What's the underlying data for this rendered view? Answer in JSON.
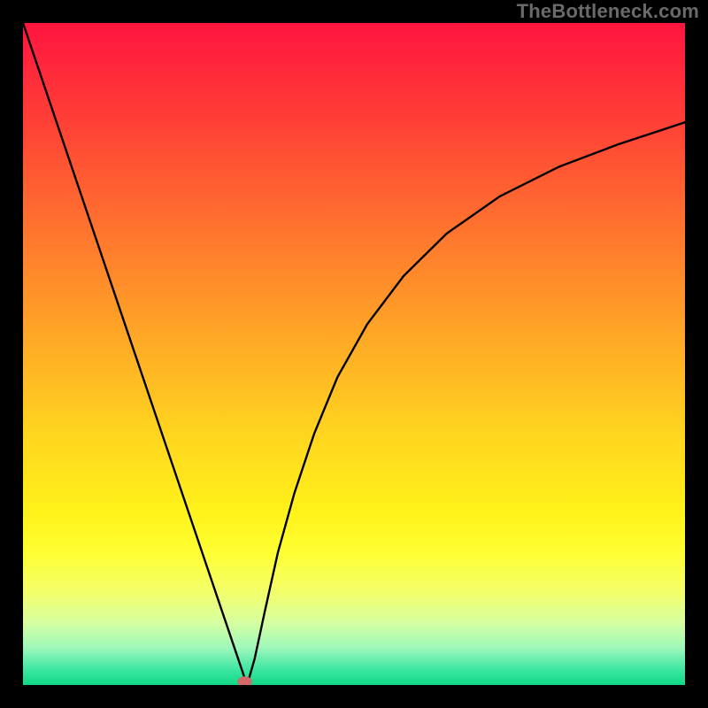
{
  "watermark": "TheBottleneck.com",
  "chart_data": {
    "type": "line",
    "title": "",
    "xlabel": "",
    "ylabel": "",
    "xlim": [
      0,
      100
    ],
    "ylim": [
      0,
      100
    ],
    "grid": false,
    "background": {
      "kind": "vertical-gradient",
      "stops": [
        {
          "offset": 0.0,
          "color": "#ff153f"
        },
        {
          "offset": 0.14,
          "color": "#ff3d37"
        },
        {
          "offset": 0.3,
          "color": "#ff702f"
        },
        {
          "offset": 0.46,
          "color": "#ffa327"
        },
        {
          "offset": 0.62,
          "color": "#ffd51f"
        },
        {
          "offset": 0.74,
          "color": "#fff21a"
        },
        {
          "offset": 0.8,
          "color": "#ffff33"
        },
        {
          "offset": 0.86,
          "color": "#f3ff6b"
        },
        {
          "offset": 0.905,
          "color": "#d7ffa0"
        },
        {
          "offset": 0.945,
          "color": "#9cf7bb"
        },
        {
          "offset": 0.975,
          "color": "#42e7a4"
        },
        {
          "offset": 1.0,
          "color": "#0fd886"
        }
      ]
    },
    "series": [
      {
        "name": "curve",
        "color": "#000000",
        "x": [
          0,
          33.5,
          33.5,
          34.0,
          35.0,
          36.5,
          38.5,
          41.0,
          44.0,
          47.5,
          52.0,
          57.5,
          64.0,
          72.0,
          81.0,
          90.0,
          100.0
        ],
        "values": [
          100,
          1.0,
          0.5,
          0.5,
          4.0,
          11.0,
          20.0,
          29.0,
          38.0,
          46.5,
          54.5,
          61.8,
          68.2,
          73.8,
          78.3,
          81.7,
          85.0
        ]
      }
    ],
    "marker": {
      "name": "min-point",
      "x": 33.5,
      "y": 0.5,
      "rx": 1.1,
      "ry": 0.8,
      "color": "#d26a6a"
    }
  }
}
